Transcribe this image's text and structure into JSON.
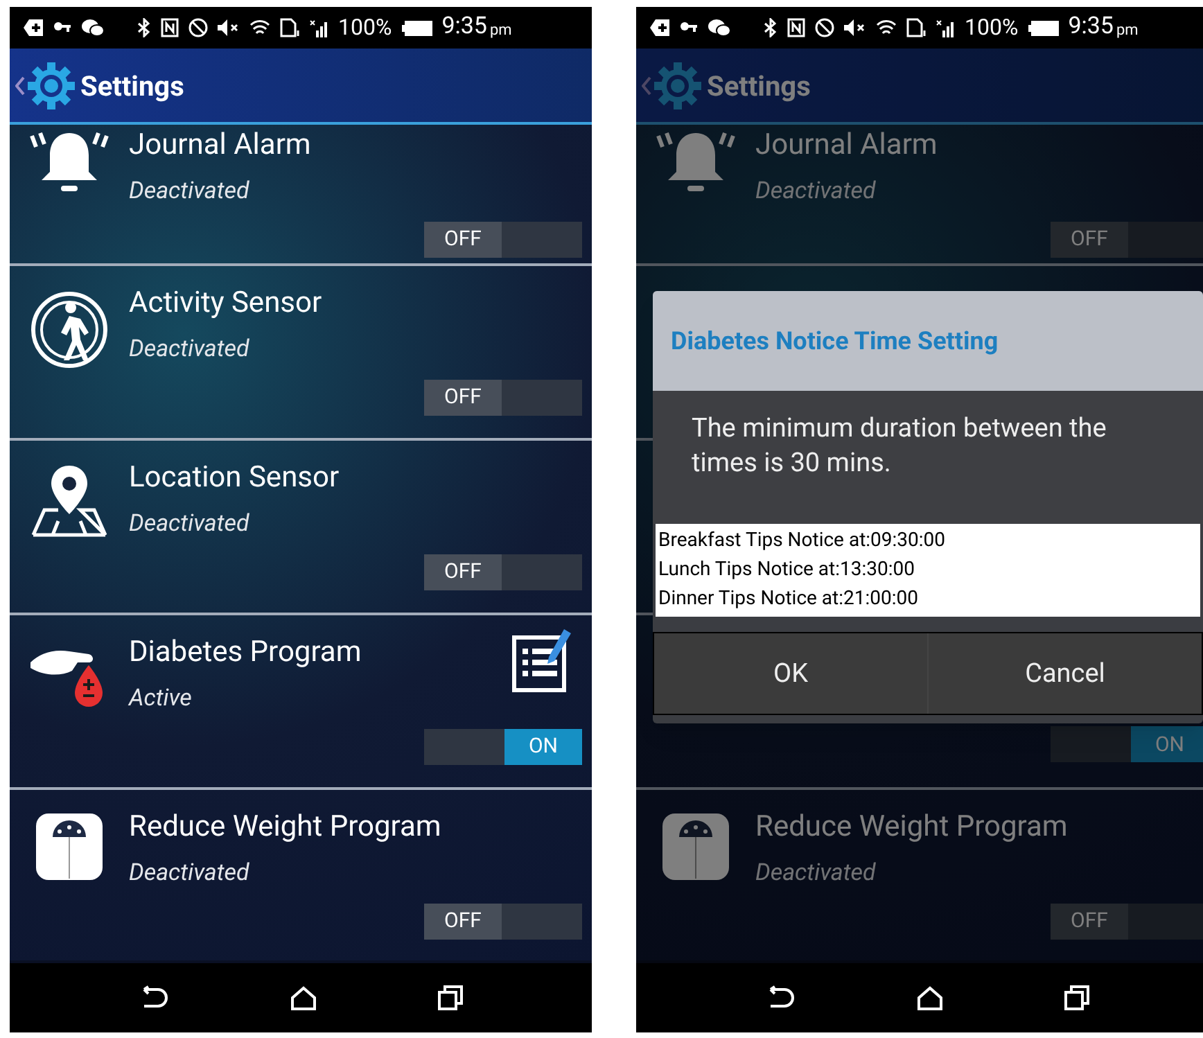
{
  "phones": [
    {
      "status_bar": {
        "battery": "100%",
        "time": "9:35",
        "ampm": "pm"
      },
      "app_bar": {
        "title": "Settings"
      },
      "dimmed": false,
      "rows": [
        {
          "kind": "bell",
          "title": "Journal Alarm",
          "subtitle": "Deactivated",
          "has_edit": false,
          "toggle": {
            "label": "OFF",
            "on": false
          }
        },
        {
          "kind": "walker",
          "title": "Activity Sensor",
          "subtitle": "Deactivated",
          "has_edit": false,
          "toggle": {
            "label": "OFF",
            "on": false
          }
        },
        {
          "kind": "location",
          "title": "Location Sensor",
          "subtitle": "Deactivated",
          "has_edit": false,
          "toggle": {
            "label": "OFF",
            "on": false
          }
        },
        {
          "kind": "diabetes",
          "title": "Diabetes Program",
          "subtitle": "Active",
          "has_edit": true,
          "toggle": {
            "label": "ON",
            "on": true
          }
        },
        {
          "kind": "scale",
          "title": "Reduce Weight Program",
          "subtitle": "Deactivated",
          "has_edit": false,
          "toggle": {
            "label": "OFF",
            "on": false
          }
        }
      ]
    },
    {
      "status_bar": {
        "battery": "100%",
        "time": "9:35",
        "ampm": "pm"
      },
      "app_bar": {
        "title": "Settings"
      },
      "dimmed": true,
      "rows": [
        {
          "kind": "bell",
          "title": "Journal Alarm",
          "subtitle": "Deactivated",
          "has_edit": false,
          "toggle": {
            "label": "OFF",
            "on": false
          }
        },
        {
          "kind": "covered"
        },
        {
          "kind": "covered"
        },
        {
          "kind": "partial",
          "has_edit": false,
          "toggle": {
            "label": "ON",
            "on": true
          }
        },
        {
          "kind": "scale",
          "title": "Reduce Weight Program",
          "subtitle": "Deactivated",
          "has_edit": false,
          "toggle": {
            "label": "OFF",
            "on": false
          }
        }
      ],
      "dialog": {
        "title": "Diabetes Notice Time Setting",
        "message": "The minimum duration between the times is 30 mins.",
        "items": [
          "Breakfast Tips Notice at:09:30:00",
          "Lunch Tips Notice at:13:30:00",
          "Dinner Tips Notice at:21:00:00"
        ],
        "buttons": [
          "OK",
          "Cancel"
        ]
      }
    }
  ]
}
